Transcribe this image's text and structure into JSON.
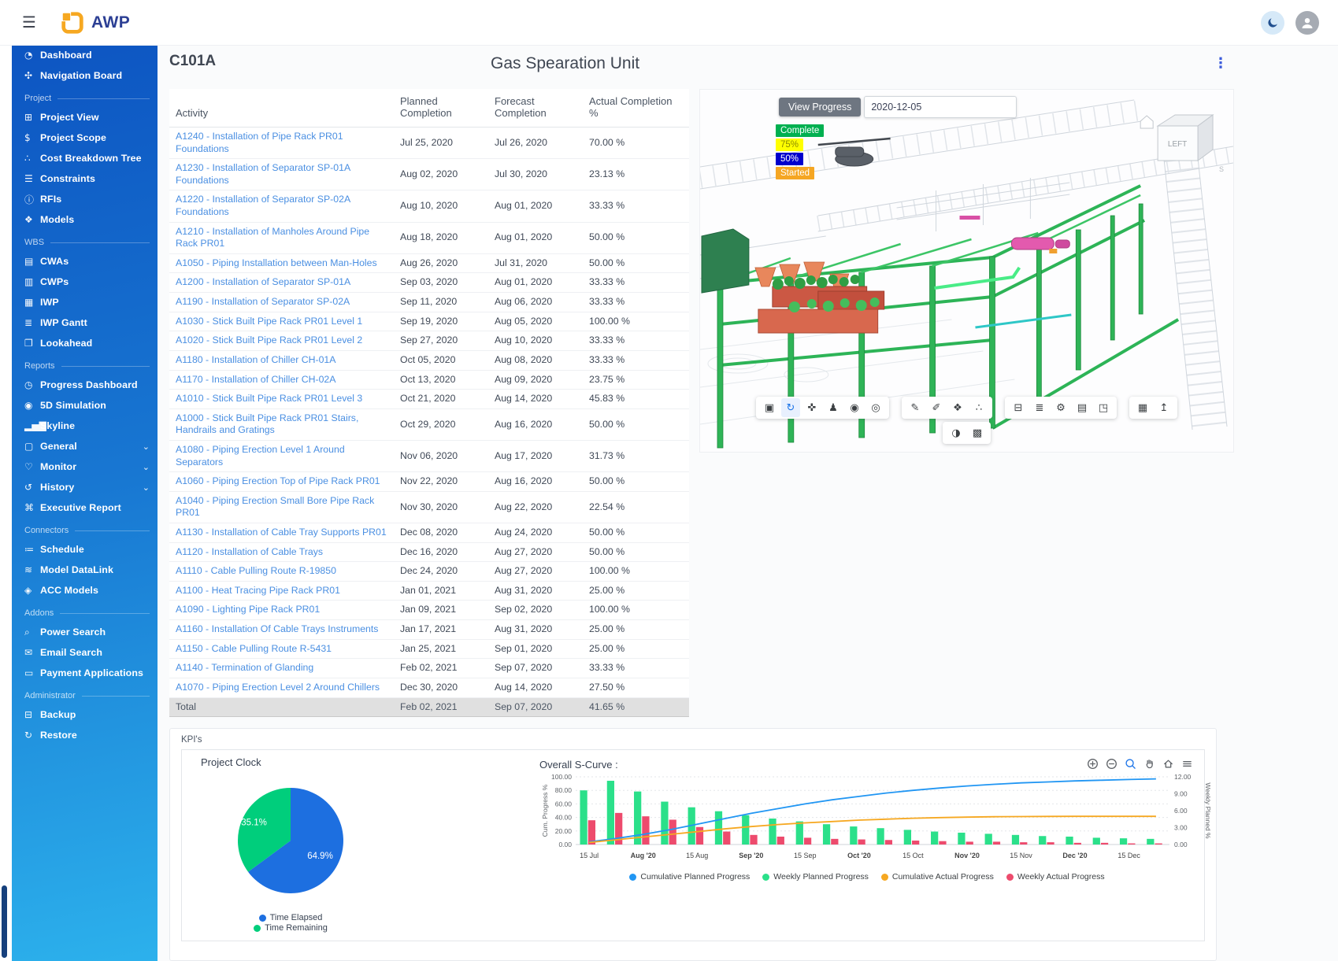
{
  "topbar": {
    "hamburger_icon": "☰",
    "logo_text": "AWP"
  },
  "header": {
    "cwa_code": "C101A",
    "title": "Gas Spearation Unit",
    "kebab_icon": "⋮"
  },
  "sidebar": {
    "sections": [
      {
        "header": "",
        "items": [
          {
            "label": "Dashboard",
            "icon_name": "dashboard-icon",
            "icon_glyph": "◔"
          },
          {
            "label": "Navigation Board",
            "icon_name": "navigation-board-icon",
            "icon_glyph": "✣"
          }
        ]
      },
      {
        "header": "Project",
        "items": [
          {
            "label": "Project View",
            "icon_name": "project-view-icon",
            "icon_glyph": "⊞"
          },
          {
            "label": "Project Scope",
            "icon_name": "project-scope-icon",
            "icon_glyph": "$"
          },
          {
            "label": "Cost Breakdown Tree",
            "icon_name": "cost-breakdown-tree-icon",
            "icon_glyph": "∴"
          },
          {
            "label": "Constraints",
            "icon_name": "constraints-icon",
            "icon_glyph": "☰"
          },
          {
            "label": "RFIs",
            "icon_name": "rfi-icon",
            "icon_glyph": "ⓘ"
          },
          {
            "label": "Models",
            "icon_name": "models-icon",
            "icon_glyph": "❖"
          }
        ]
      },
      {
        "header": "WBS",
        "items": [
          {
            "label": "CWAs",
            "icon_name": "cwas-icon",
            "icon_glyph": "▤"
          },
          {
            "label": "CWPs",
            "icon_name": "cwps-icon",
            "icon_glyph": "▥"
          },
          {
            "label": "IWP",
            "icon_name": "iwp-icon",
            "icon_glyph": "▦"
          },
          {
            "label": "IWP Gantt",
            "icon_name": "iwp-gantt-icon",
            "icon_glyph": "≣"
          },
          {
            "label": "Lookahead",
            "icon_name": "lookahead-icon",
            "icon_glyph": "❐"
          }
        ]
      },
      {
        "header": "Reports",
        "items": [
          {
            "label": "Progress Dashboard",
            "icon_name": "progress-dashboard-icon",
            "icon_glyph": "◷"
          },
          {
            "label": "5D Simulation",
            "icon_name": "simulation-icon",
            "icon_glyph": "◉"
          },
          {
            "label": "Skyline",
            "icon_name": "skyline-icon",
            "icon_glyph": "▂▅▇"
          },
          {
            "label": "General",
            "icon_name": "general-icon",
            "icon_glyph": "▢",
            "expandable": true
          },
          {
            "label": "Monitor",
            "icon_name": "monitor-icon",
            "icon_glyph": "♡",
            "expandable": true
          },
          {
            "label": "History",
            "icon_name": "history-icon",
            "icon_glyph": "↺",
            "expandable": true
          },
          {
            "label": "Executive Report",
            "icon_name": "executive-report-icon",
            "icon_glyph": "⌘"
          }
        ]
      },
      {
        "header": "Connectors",
        "items": [
          {
            "label": "Schedule",
            "icon_name": "schedule-icon",
            "icon_glyph": "≔"
          },
          {
            "label": "Model DataLink",
            "icon_name": "model-datalink-icon",
            "icon_glyph": "≋"
          },
          {
            "label": "ACC Models",
            "icon_name": "acc-models-icon",
            "icon_glyph": "◈"
          }
        ]
      },
      {
        "header": "Addons",
        "items": [
          {
            "label": "Power Search",
            "icon_name": "power-search-icon",
            "icon_glyph": "⌕"
          },
          {
            "label": "Email Search",
            "icon_name": "email-search-icon",
            "icon_glyph": "✉"
          },
          {
            "label": "Payment Applications",
            "icon_name": "payment-applications-icon",
            "icon_glyph": "▭"
          }
        ]
      },
      {
        "header": "Administrator",
        "items": [
          {
            "label": "Backup",
            "icon_name": "backup-icon",
            "icon_glyph": "⊟"
          },
          {
            "label": "Restore",
            "icon_name": "restore-icon",
            "icon_glyph": "↻"
          }
        ]
      }
    ]
  },
  "activity_table": {
    "columns": [
      "Activity",
      "Planned Completion",
      "Forecast Completion",
      "Actual Completion %"
    ],
    "rows": [
      [
        "A1240 - Installation of Pipe Rack PR01 Foundations",
        "Jul 25, 2020",
        "Jul 26, 2020",
        "70.00 %"
      ],
      [
        "A1230 - Installation of Separator SP-01A Foundations",
        "Aug 02, 2020",
        "Jul 30, 2020",
        "23.13 %"
      ],
      [
        "A1220 - Installation of Separator SP-02A Foundations",
        "Aug 10, 2020",
        "Aug 01, 2020",
        "33.33 %"
      ],
      [
        "A1210 - Installation of Manholes Around Pipe Rack PR01",
        "Aug 18, 2020",
        "Aug 01, 2020",
        "50.00 %"
      ],
      [
        "A1050 - Piping Installation between Man-Holes",
        "Aug 26, 2020",
        "Jul 31, 2020",
        "50.00 %"
      ],
      [
        "A1200 - Installation of Separator SP-01A",
        "Sep 03, 2020",
        "Aug 01, 2020",
        "33.33 %"
      ],
      [
        "A1190 - Installation of Separator SP-02A",
        "Sep 11, 2020",
        "Aug 06, 2020",
        "33.33 %"
      ],
      [
        "A1030 - Stick Built Pipe Rack PR01 Level 1",
        "Sep 19, 2020",
        "Aug 05, 2020",
        "100.00 %"
      ],
      [
        "A1020 - Stick Built Pipe Rack PR01 Level 2",
        "Sep 27, 2020",
        "Aug 10, 2020",
        "33.33 %"
      ],
      [
        "A1180 - Installation of Chiller CH-01A",
        "Oct 05, 2020",
        "Aug 08, 2020",
        "33.33 %"
      ],
      [
        "A1170 - Installation of Chiller CH-02A",
        "Oct 13, 2020",
        "Aug 09, 2020",
        "23.75 %"
      ],
      [
        "A1010 - Stick Built Pipe Rack PR01 Level 3",
        "Oct 21, 2020",
        "Aug 14, 2020",
        "45.83 %"
      ],
      [
        "A1000 - Stick Built Pipe Rack PR01 Stairs, Handrails and Gratings",
        "Oct 29, 2020",
        "Aug 16, 2020",
        "50.00 %"
      ],
      [
        "A1080 - Piping Erection Level 1 Around Separators",
        "Nov 06, 2020",
        "Aug 17, 2020",
        "31.73 %"
      ],
      [
        "A1060 - Piping Erection Top of Pipe Rack PR01",
        "Nov 22, 2020",
        "Aug 16, 2020",
        "50.00 %"
      ],
      [
        "A1040 - Piping Erection Small Bore Pipe Rack PR01",
        "Nov 30, 2020",
        "Aug 22, 2020",
        "22.54 %"
      ],
      [
        "A1130 - Installation of Cable Tray Supports PR01",
        "Dec 08, 2020",
        "Aug 24, 2020",
        "50.00 %"
      ],
      [
        "A1120 - Installation of Cable Trays",
        "Dec 16, 2020",
        "Aug 27, 2020",
        "50.00 %"
      ],
      [
        "A1110 - Cable Pulling Route R-19850",
        "Dec 24, 2020",
        "Aug 27, 2020",
        "100.00 %"
      ],
      [
        "A1100 - Heat Tracing Pipe Rack PR01",
        "Jan 01, 2021",
        "Aug 31, 2020",
        "25.00 %"
      ],
      [
        "A1090 - Lighting Pipe Rack PR01",
        "Jan 09, 2021",
        "Sep 02, 2020",
        "100.00 %"
      ],
      [
        "A1160 - Installation Of Cable Trays Instruments",
        "Jan 17, 2021",
        "Aug 31, 2020",
        "25.00 %"
      ],
      [
        "A1150 - Cable Pulling Route R-5431",
        "Jan 25, 2021",
        "Sep 01, 2020",
        "25.00 %"
      ],
      [
        "A1140 - Termination of Glanding",
        "Feb 02, 2021",
        "Sep 07, 2020",
        "33.33 %"
      ],
      [
        "A1070 - Piping Erection Level 2 Around Chillers",
        "Dec 30, 2020",
        "Aug 14, 2020",
        "27.50 %"
      ]
    ],
    "total_row": {
      "label": "Total",
      "planned": "Feb 02, 2021",
      "forecast": "Sep 07, 2020",
      "actual": "41.65 %"
    }
  },
  "viewer": {
    "view_progress_button": "View Progress",
    "date_value": "2020-12-05",
    "cube_label": "LEFT",
    "compass_s": "S",
    "legend": [
      {
        "label": "Complete",
        "bg": "#00b050",
        "fg": "#ffffff"
      },
      {
        "label": "75%",
        "bg": "#ffff00",
        "fg": "#8a8a00"
      },
      {
        "label": "50%",
        "bg": "#0000cc",
        "fg": "#ffffff"
      },
      {
        "label": "Started",
        "bg": "#f5a623",
        "fg": "#ffffff"
      }
    ],
    "toolbars": [
      {
        "icons": [
          {
            "name": "window-select-icon",
            "glyph": "▣"
          },
          {
            "name": "orbit-icon",
            "glyph": "↻",
            "active": true
          },
          {
            "name": "pan-hand-icon",
            "glyph": "✜"
          },
          {
            "name": "walkthrough-icon",
            "glyph": "♟"
          },
          {
            "name": "video-camera-icon",
            "glyph": "◉"
          },
          {
            "name": "snapshot-camera-icon",
            "glyph": "◎"
          }
        ]
      },
      {
        "icons": [
          {
            "name": "measure-icon",
            "glyph": "✎"
          },
          {
            "name": "markup-icon",
            "glyph": "✐"
          },
          {
            "name": "explode-icon",
            "glyph": "❖"
          },
          {
            "name": "point-cloud-icon",
            "glyph": "∴"
          }
        ]
      },
      {
        "icons": [
          {
            "name": "model-tree-icon",
            "glyph": "⊟"
          },
          {
            "name": "layers-icon",
            "glyph": "≣"
          },
          {
            "name": "settings-gear-icon",
            "glyph": "⚙"
          },
          {
            "name": "properties-icon",
            "glyph": "▤"
          },
          {
            "name": "export-icon",
            "glyph": "◳"
          }
        ]
      },
      {
        "icons": [
          {
            "name": "map-icon",
            "glyph": "▦"
          },
          {
            "name": "elevation-icon",
            "glyph": "↥"
          }
        ]
      }
    ],
    "toolbar_row2": {
      "icons": [
        {
          "name": "palette-icon",
          "glyph": "◑"
        },
        {
          "name": "image-icon",
          "glyph": "▩"
        }
      ]
    }
  },
  "kpi": {
    "section_title": "KPI's",
    "project_clock_title": "Project Clock",
    "s_curve_title": "Overall S-Curve :",
    "toolbar_icon_names": [
      "zoom-in",
      "zoom-out",
      "zoom-select",
      "pan",
      "home",
      "menu"
    ]
  },
  "chart_data": [
    {
      "type": "pie",
      "title": "Project Clock",
      "labels": [
        "Time Elapsed",
        "Time Remaining"
      ],
      "values": [
        64.9,
        35.1
      ],
      "colors": [
        "#1d6fe0",
        "#00ce7c"
      ],
      "legend_position": "bottom"
    },
    {
      "type": "line+bar",
      "title": "Overall S-Curve :",
      "x_tick_labels": [
        "15 Jul",
        "Aug '20",
        "15 Aug",
        "Sep '20",
        "15 Sep",
        "Oct '20",
        "15 Oct",
        "Nov '20",
        "15 Nov",
        "Dec '20",
        "15 Dec"
      ],
      "y_left": {
        "label": "Cum. Progress %",
        "range": [
          0,
          100
        ],
        "ticks": [
          "100.00",
          "80.00",
          "60.00",
          "40.00",
          "20.00",
          "0.00"
        ]
      },
      "y_right": {
        "label": "Weekly Planned %",
        "range": [
          0,
          12
        ],
        "ticks": [
          "12.00",
          "9.00",
          "6.00",
          "3.00",
          "0.00"
        ]
      },
      "grid": true,
      "legend_position": "bottom",
      "series": [
        {
          "name": "Cumulative Planned Progress",
          "type": "line",
          "axis": "left",
          "color": "#2196f3",
          "values": [
            4,
            9,
            15,
            22,
            30,
            38,
            46,
            53,
            60,
            66,
            71,
            76,
            80,
            83.5,
            86.5,
            89,
            91,
            92.5,
            94,
            95,
            96,
            97
          ]
        },
        {
          "name": "Weekly Planned Progress",
          "type": "bar",
          "axis": "right",
          "color": "#2be08a",
          "values": [
            9.6,
            11.3,
            9.4,
            7.6,
            6.6,
            5.9,
            5.2,
            4.6,
            4.1,
            3.6,
            3.2,
            2.9,
            2.6,
            2.3,
            2.1,
            1.9,
            1.7,
            1.5,
            1.4,
            1.2,
            1.1,
            1.0
          ]
        },
        {
          "name": "Cumulative Actual Progress",
          "type": "line",
          "axis": "left",
          "color": "#f6a821",
          "values": [
            3,
            7,
            11,
            15,
            19,
            23,
            26.5,
            29.5,
            32,
            34,
            36,
            37.5,
            38.8,
            39.8,
            40.5,
            41,
            41.3,
            41.5,
            41.65,
            41.65,
            41.65,
            41.65
          ]
        },
        {
          "name": "Weekly Actual Progress",
          "type": "bar",
          "axis": "right",
          "color": "#ed4b6d",
          "values": [
            4.3,
            5.6,
            5.0,
            4.4,
            3.1,
            2.3,
            1.7,
            1.4,
            1.2,
            1.0,
            0.9,
            0.8,
            0.7,
            0.6,
            0.5,
            0.5,
            0.4,
            0.4,
            0.3,
            0.3,
            0.2,
            0.2
          ]
        }
      ]
    }
  ]
}
